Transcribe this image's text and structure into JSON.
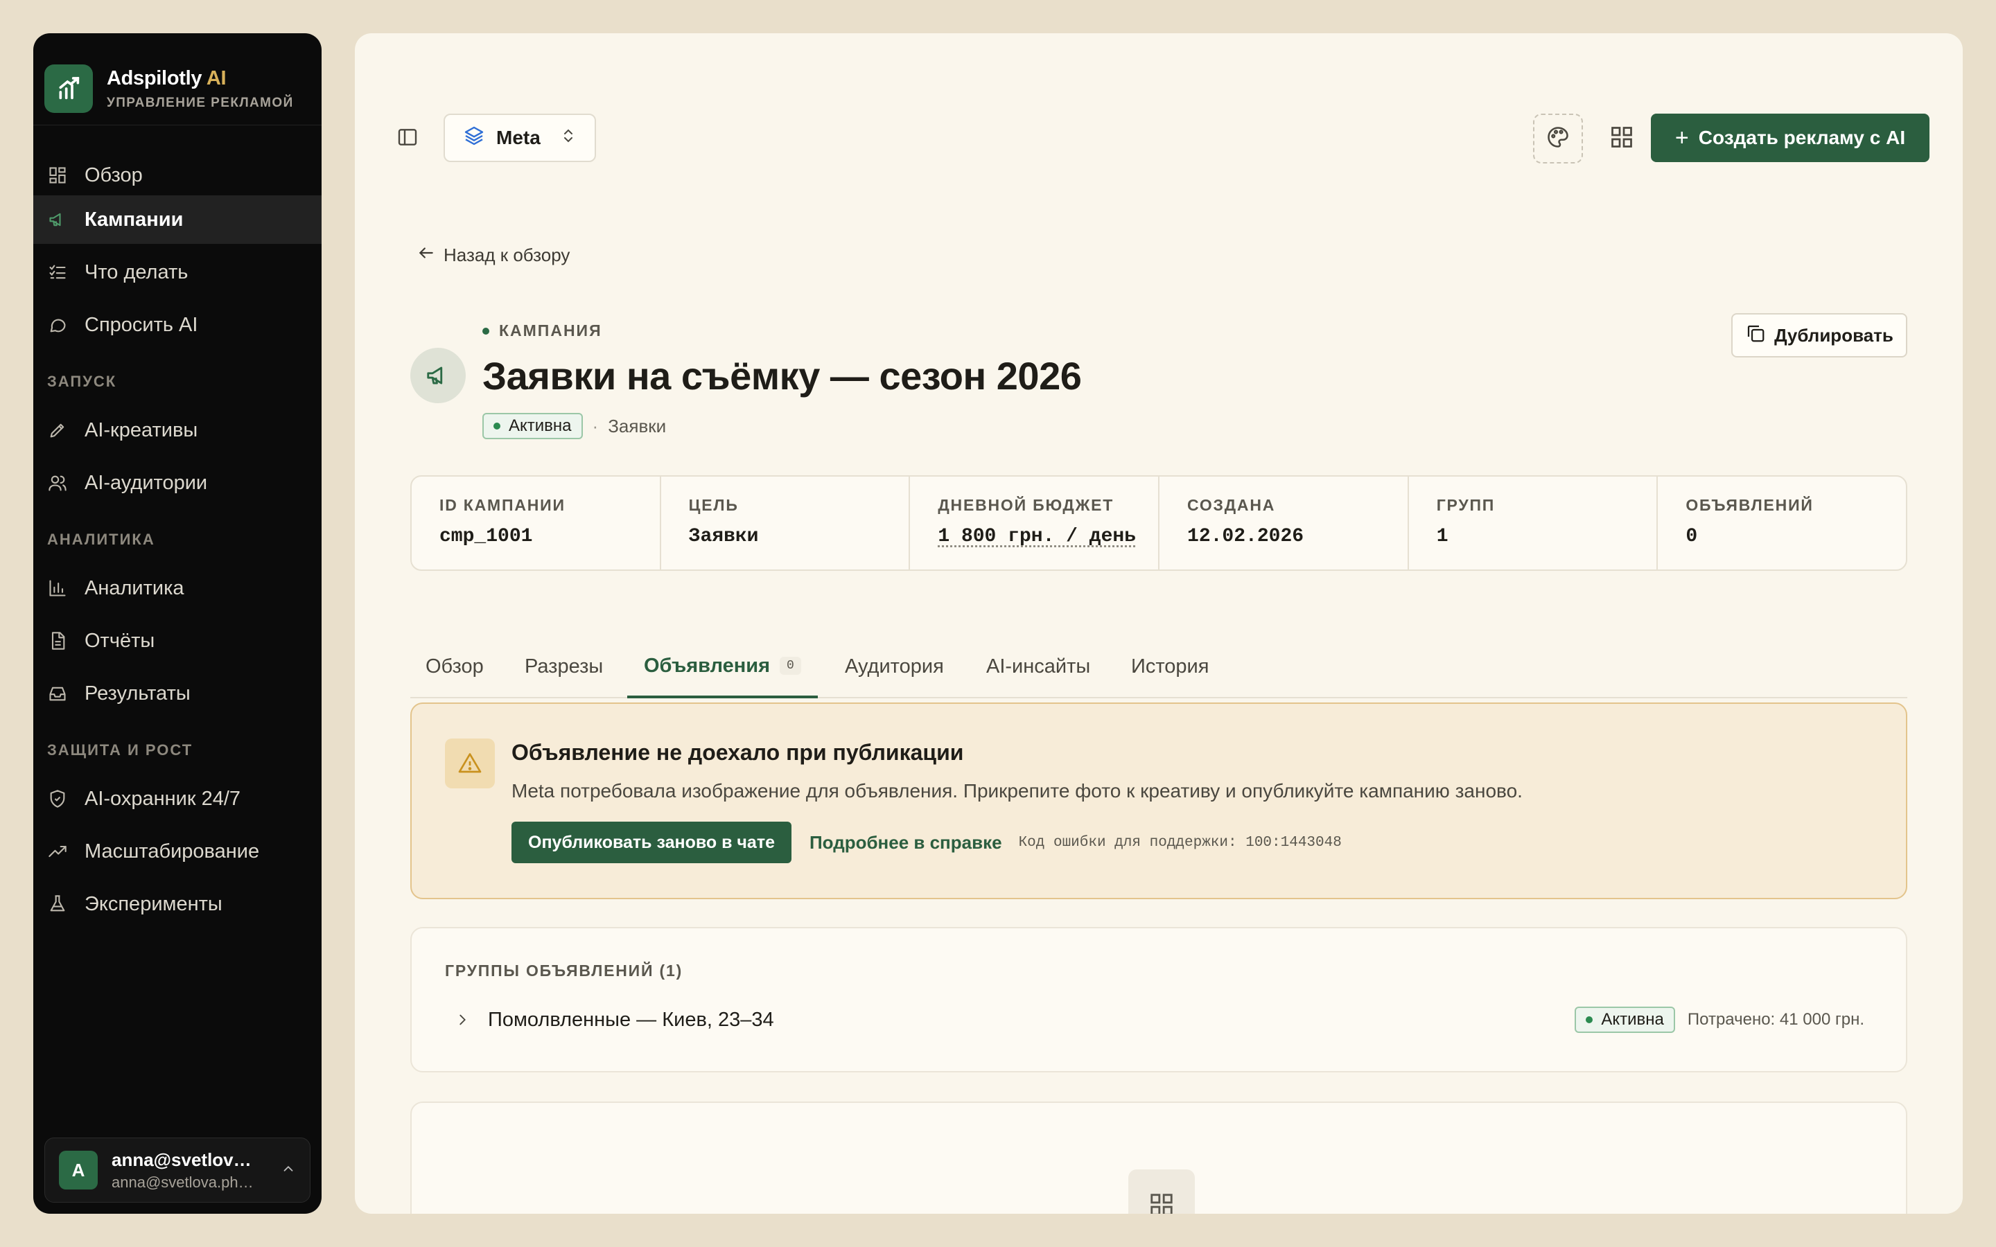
{
  "brand": {
    "name": "Adspilotly",
    "name_ai": "AI",
    "subtitle": "УПРАВЛЕНИЕ РЕКЛАМОЙ",
    "color": "#2b6a45"
  },
  "sidebar": {
    "items": [
      {
        "label": "Обзор",
        "icon": "dashboard-icon"
      },
      {
        "label": "Кампании",
        "icon": "megaphone-icon",
        "active": true
      },
      {
        "label": "Что делать",
        "icon": "checklist-icon"
      },
      {
        "label": "Спросить AI",
        "icon": "chat-icon"
      }
    ],
    "section_launch": "ЗАПУСК",
    "launch_items": [
      {
        "label": "AI-креативы",
        "icon": "pen-icon"
      },
      {
        "label": "AI-аудитории",
        "icon": "users-icon"
      }
    ],
    "section_analytics": "АНАЛИТИКА",
    "analytics_items": [
      {
        "label": "Аналитика",
        "icon": "bar-chart-icon"
      },
      {
        "label": "Отчёты",
        "icon": "document-icon"
      },
      {
        "label": "Результаты",
        "icon": "inbox-icon"
      }
    ],
    "section_growth": "ЗАЩИТА И РОСТ",
    "growth_items": [
      {
        "label": "AI-охранник 24/7",
        "icon": "shield-icon"
      },
      {
        "label": "Масштабирование",
        "icon": "trending-up-icon"
      },
      {
        "label": "Эксперименты",
        "icon": "flask-icon"
      }
    ]
  },
  "user": {
    "initial": "A",
    "email": "anna@svetlova.photo",
    "email2": "anna@svetlova.photo"
  },
  "toolbar": {
    "platform": "Meta",
    "create_label": "Создать рекламу с AI",
    "accent": "#2b5e3f"
  },
  "back_label": "Назад к обзору",
  "campaign": {
    "kicker": "КАМПАНИЯ",
    "title": "Заявки на съёмку — сезон 2026",
    "status": "Активна",
    "objective_tag": "Заявки",
    "duplicate_label": "Дублировать"
  },
  "stats": [
    {
      "label": "ID КАМПАНИИ",
      "value": "cmp_1001"
    },
    {
      "label": "ЦЕЛЬ",
      "value": "Заявки"
    },
    {
      "label": "ДНЕВНОЙ БЮДЖЕТ",
      "value": "1 800 грн. / день"
    },
    {
      "label": "СОЗДАНА",
      "value": "12.02.2026"
    },
    {
      "label": "ГРУПП",
      "value": "1"
    },
    {
      "label": "ОБЪЯВЛЕНИЙ",
      "value": "0"
    }
  ],
  "tabs": [
    {
      "label": "Обзор"
    },
    {
      "label": "Разрезы"
    },
    {
      "label": "Объявления",
      "count": "0",
      "active": true
    },
    {
      "label": "Аудитория"
    },
    {
      "label": "AI-инсайты"
    },
    {
      "label": "История"
    }
  ],
  "alert": {
    "title": "Объявление не доехало при публикации",
    "text": "Meta потребовала изображение для объявления. Прикрепите фото к креативу и опубликуйте кампанию заново.",
    "primary_label": "Опубликовать заново в чате",
    "link_label": "Подробнее в справке",
    "error_code": "Код ошибки для поддержки: 100:1443048",
    "color": "#f7ecd8"
  },
  "groups": {
    "title": "ГРУППЫ ОБЪЯВЛЕНИЙ (1)",
    "items": [
      {
        "name": "Помолвленные — Киев, 23–34",
        "status": "Активна",
        "spent": "Потрачено: 41 000 грн."
      }
    ]
  }
}
